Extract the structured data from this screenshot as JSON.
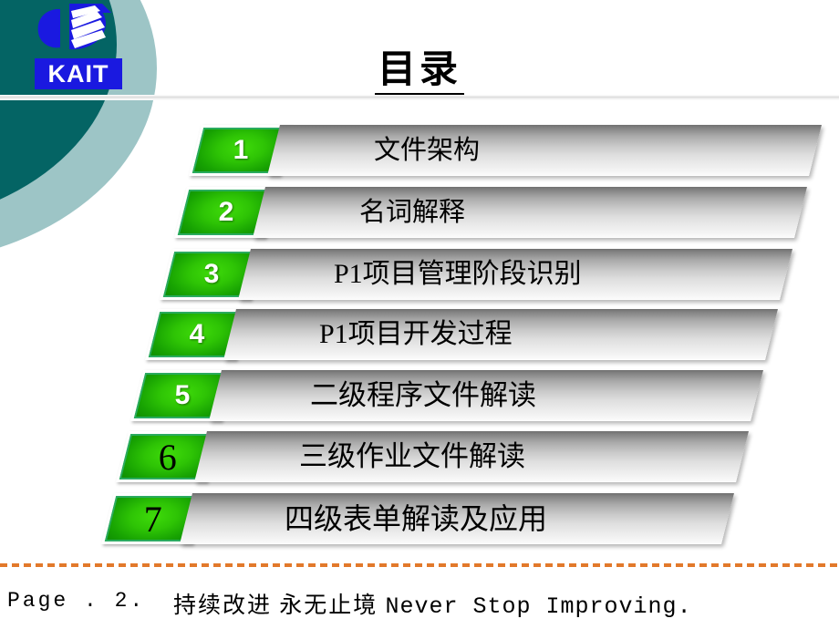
{
  "slide": {
    "title": "目录",
    "page_number": "Page . 2."
  },
  "logo": {
    "mark": "kait-logo-mark",
    "wordmark": "KAIT",
    "mark_color": "#1a19e0",
    "box_color": "#1a19e0"
  },
  "decoration": {
    "dark_teal": "#046464",
    "light_teal": "#9dc5c6",
    "accent_green": "#2ec405",
    "dash_orange": "#e2792b"
  },
  "toc": {
    "items": [
      {
        "number": "1",
        "label": "文件架构",
        "num_style": "white"
      },
      {
        "number": "2",
        "label": "名词解释",
        "num_style": "white"
      },
      {
        "number": "3",
        "label": "P1项目管理阶段识别",
        "num_style": "white"
      },
      {
        "number": "4",
        "label": "P1项目开发过程",
        "num_style": "white"
      },
      {
        "number": "5",
        "label": "二级程序文件解读",
        "num_style": "white"
      },
      {
        "number": "6",
        "label": "三级作业文件解读",
        "num_style": "dark"
      },
      {
        "number": "7",
        "label": "四级表单解读及应用",
        "num_style": "dark"
      }
    ]
  },
  "footer": {
    "page": "Page . 2.",
    "slogan_cn": "持续改进  永无止境",
    "slogan_en": "Never  Stop  Improving."
  }
}
